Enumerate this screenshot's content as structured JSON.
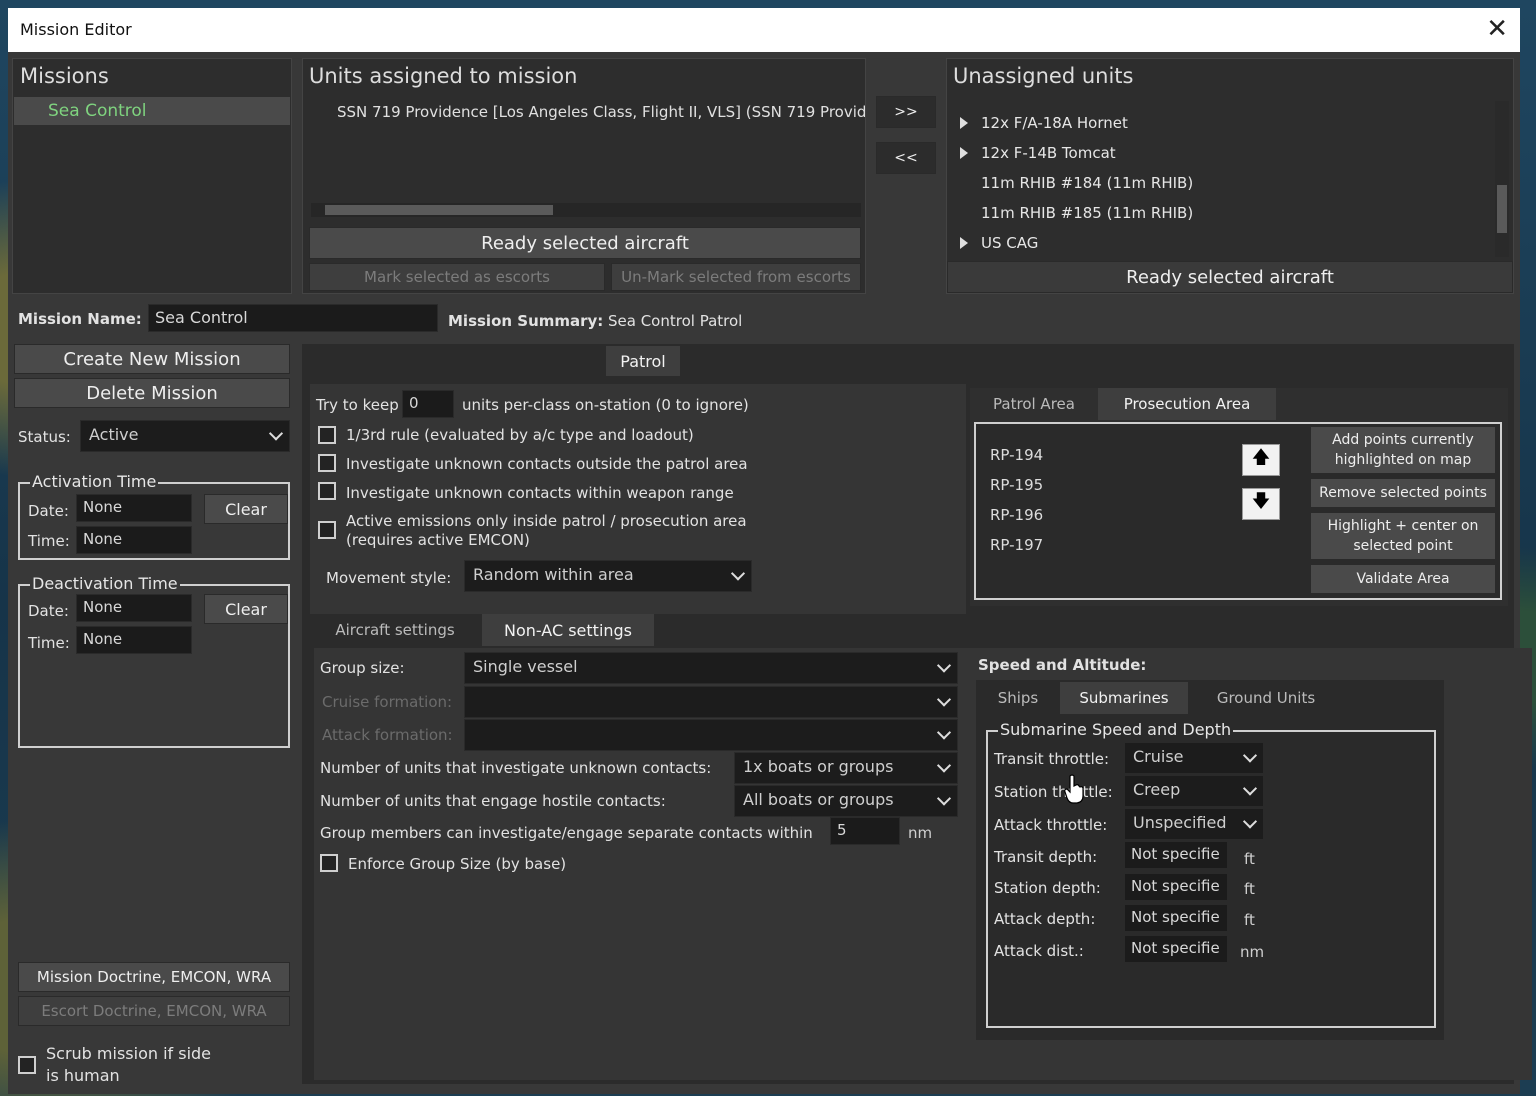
{
  "window": {
    "title": "Mission Editor",
    "close_glyph": "✕"
  },
  "missions": {
    "header": "Missions",
    "items": [
      "Sea Control"
    ]
  },
  "assigned": {
    "header": "Units assigned to mission",
    "items": [
      "SSN 719 Providence [Los Angeles Class, Flight II, VLS] (SSN 719 Provid"
    ],
    "ready_label": "Ready selected aircraft",
    "mark_escorts_label": "Mark selected as escorts",
    "unmark_escorts_label": "Un-Mark selected from escorts"
  },
  "transfer": {
    "assign_label": ">>",
    "unassign_label": "<<"
  },
  "unassigned": {
    "header": "Unassigned units",
    "items": [
      {
        "label": "12x F/A-18A Hornet",
        "expandable": true
      },
      {
        "label": "12x F-14B Tomcat",
        "expandable": true
      },
      {
        "label": "11m RHIB #184 (11m RHIB)",
        "expandable": false
      },
      {
        "label": "11m RHIB #185 (11m RHIB)",
        "expandable": false
      },
      {
        "label": "US CAG",
        "expandable": true
      }
    ],
    "ready_label": "Ready selected aircraft"
  },
  "mission_name": {
    "label": "Mission Name:",
    "value": "Sea Control"
  },
  "mission_summary": {
    "label": "Mission Summary:",
    "value": "Sea Control Patrol"
  },
  "left_actions": {
    "create": "Create New Mission",
    "delete": "Delete Mission"
  },
  "status": {
    "label": "Status:",
    "value": "Active"
  },
  "activation": {
    "title": "Activation Time",
    "date_label": "Date:",
    "date_value": "None",
    "time_label": "Time:",
    "time_value": "None",
    "clear_label": "Clear"
  },
  "deactivation": {
    "title": "Deactivation Time",
    "date_label": "Date:",
    "date_value": "None",
    "time_label": "Time:",
    "time_value": "None",
    "clear_label": "Clear"
  },
  "doctrine": {
    "mission": "Mission Doctrine, EMCON, WRA",
    "escort": "Escort Doctrine, EMCON, WRA"
  },
  "scrub": {
    "line1": "Scrub mission if side",
    "line2": "is human"
  },
  "patrol": {
    "tab_label": "Patrol",
    "try_keep_pre": "Try to keep",
    "try_keep_value": "0",
    "try_keep_post": "units per-class on-station (0 to ignore)",
    "options": [
      "1/3rd rule (evaluated by a/c type and loadout)",
      "Investigate unknown contacts outside the patrol area",
      "Investigate unknown contacts within weapon range"
    ],
    "emissions_line1": "Active emissions only inside patrol / prosecution area",
    "emissions_line2": "(requires active EMCON)",
    "movement_label": "Movement style:",
    "movement_value": "Random within area"
  },
  "area": {
    "tabs": [
      "Patrol Area",
      "Prosecution Area"
    ],
    "points": [
      "RP-194",
      "RP-195",
      "RP-196",
      "RP-197"
    ],
    "up_glyph": "🡅",
    "down_glyph": "🡇",
    "add_line1": "Add points currently",
    "add_line2": "highlighted on map",
    "remove_label": "Remove selected points",
    "highlight_line1": "Highlight + center on",
    "highlight_line2": "selected point",
    "validate_label": "Validate Area"
  },
  "settings_tabs": [
    "Aircraft settings",
    "Non-AC settings"
  ],
  "nonac": {
    "group_size_label": "Group size:",
    "group_size_value": "Single vessel",
    "cruise_label": "Cruise formation:",
    "attack_label": "Attack formation:",
    "investigate_label": "Number of units that investigate unknown contacts:",
    "investigate_value": "1x boats or groups",
    "engage_label": "Number of units that engage hostile contacts:",
    "engage_value": "All boats or groups",
    "separate_label": "Group members can investigate/engage separate contacts within",
    "separate_value": "5",
    "separate_unit": "nm",
    "enforce_label": "Enforce Group Size (by base)"
  },
  "speed": {
    "header": "Speed and Altitude:",
    "tabs": [
      "Ships",
      "Submarines",
      "Ground Units"
    ],
    "group_title": "Submarine Speed and Depth",
    "transit_throttle_label": "Transit throttle:",
    "transit_throttle_value": "Cruise",
    "station_throttle_label": "Station throttle:",
    "station_throttle_value": "Creep",
    "attack_throttle_label": "Attack throttle:",
    "attack_throttle_value": "Unspecified",
    "transit_depth_label": "Transit depth:",
    "transit_depth_value": "Not specifie",
    "station_depth_label": "Station depth:",
    "station_depth_value": "Not specifie",
    "attack_depth_label": "Attack depth:",
    "attack_depth_value": "Not specifie",
    "attack_dist_label": "Attack dist.:",
    "attack_dist_value": "Not specifie",
    "unit_ft": "ft",
    "unit_nm": "nm"
  },
  "colors": {
    "selected_mission": "#7fd37f",
    "window_bg": "#383838",
    "panel_bg": "#2d2d2d"
  }
}
